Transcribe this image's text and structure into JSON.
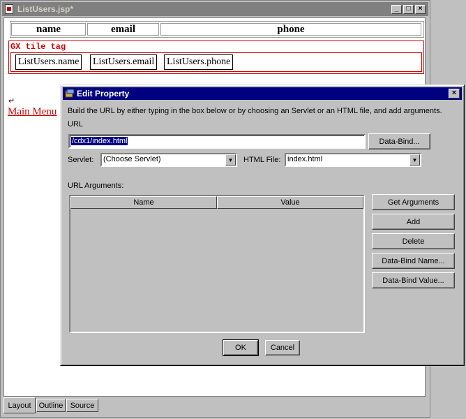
{
  "editor": {
    "title": "ListUsers.jsp*",
    "controls": {
      "minimize": "_",
      "maximize": "□",
      "close": "×"
    },
    "headers": [
      "name",
      "email",
      "phone"
    ],
    "tile_label": "GX tile tag",
    "tile_cells": [
      "ListUsers.name",
      "ListUsers.email",
      "ListUsers.phone"
    ],
    "return_mark": "↵",
    "main_menu_link": "Main Menu",
    "tabs": [
      "Layout",
      "Outline",
      "Source"
    ]
  },
  "dialog": {
    "title": "Edit Property",
    "close": "×",
    "instructions": "Build the URL by either typing in the box below or by choosing an Servlet or an HTML file, and add arguments.",
    "url_label": "URL",
    "url_value": "/cdx1/index.html",
    "data_bind_button": "Data-Bind...",
    "servlet_label": "Servlet:",
    "servlet_value": "(Choose Servlet)",
    "html_file_label": "HTML File:",
    "html_file_value": "index.html",
    "url_args_label": "URL Arguments:",
    "columns": [
      "Name",
      "Value"
    ],
    "side_buttons": [
      "Get Arguments",
      "Add",
      "Delete",
      "Data-Bind Name...",
      "Data-Bind Value..."
    ],
    "ok": "OK",
    "cancel": "Cancel"
  },
  "colors": {
    "title_active": "#000080",
    "title_inactive": "#808080",
    "tag_red": "#d00000",
    "face": "#c0c0c0"
  }
}
